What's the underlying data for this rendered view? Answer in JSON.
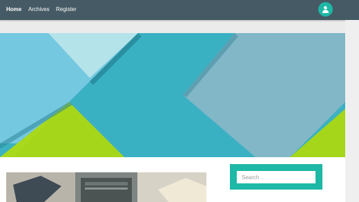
{
  "nav": {
    "links": [
      {
        "label": "Home",
        "active": true
      },
      {
        "label": "Archives",
        "active": false
      },
      {
        "label": "Register",
        "active": false
      }
    ],
    "avatar_icon": "user-avatar-icon"
  },
  "search": {
    "placeholder": "Search ..",
    "value": ""
  },
  "colors": {
    "navbar": "#455a64",
    "accent": "#1eb8a6",
    "background": "#ebebeb"
  }
}
